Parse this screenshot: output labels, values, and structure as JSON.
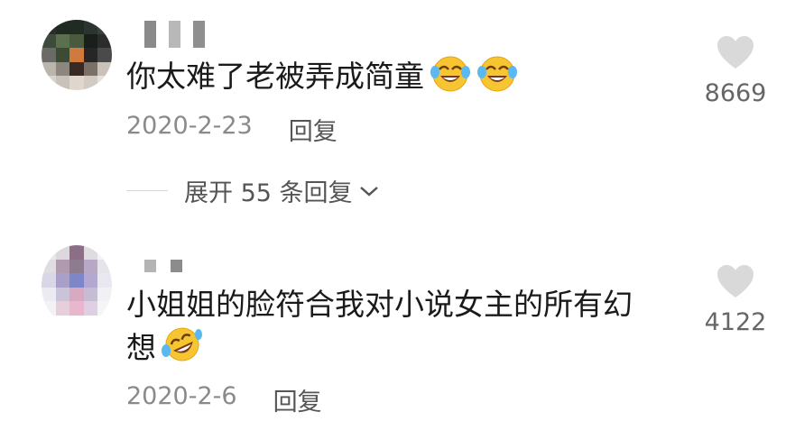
{
  "comments": [
    {
      "text": "你太难了老被弄成简童",
      "emojis": [
        "crying-laughing-emoji",
        "crying-laughing-emoji"
      ],
      "date": "2020-2-23",
      "reply_label": "回复",
      "likes": "8669",
      "expand_label": "展开 55 条回复"
    },
    {
      "text_line1": "小姐姐的脸符合我对小说女主的所有幻",
      "text_line2": "想",
      "emojis": [
        "rolling-laughing-emoji"
      ],
      "date": "2020-2-6",
      "reply_label": "回复",
      "likes": "4122"
    }
  ]
}
